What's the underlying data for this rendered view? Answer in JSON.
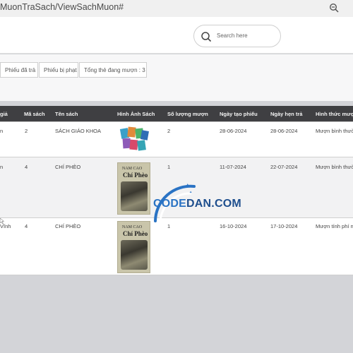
{
  "browser": {
    "url_path": "MuonTraSach/ViewSachMuon#"
  },
  "header": {
    "search_placeholder": "Search here"
  },
  "tabs": [
    {
      "label": "Phiếu đã trả"
    },
    {
      "label": "Phiếu bị phạt"
    },
    {
      "label": "Tổng thẻ đang mượn : 3"
    }
  ],
  "table": {
    "columns": [
      "giả",
      "Mã sách",
      "Tên sách",
      "Hình Ảnh Sách",
      "Số lượng mượn",
      "Ngày tạo phiếu",
      "Ngày hẹn trả",
      "Hình thức mượn"
    ],
    "rows": [
      {
        "reader": "n",
        "book_id": "2",
        "title": "SÁCH GIÁO KHOA",
        "image": "textbook-stack",
        "qty": "2",
        "created": "28-06-2024",
        "due": "28-06-2024",
        "mode": "Mượn bình thường"
      },
      {
        "reader": "n",
        "book_id": "4",
        "title": "CHÍ PHÈO",
        "image": "chi-pheo-cover",
        "qty": "1",
        "created": "11-07-2024",
        "due": "22-07-2024",
        "mode": "Mượn bình thường"
      },
      {
        "reader": "Vĩnh",
        "book_id": "4",
        "title": "CHÍ PHÈO",
        "image": "chi-pheo-cover",
        "qty": "1",
        "created": "16-10-2024",
        "due": "17-10-2024",
        "mode": "Mượn tính phí n"
      }
    ]
  },
  "covers": {
    "small_title": "NAM CAO",
    "big_title": "Chí Phèo"
  },
  "watermark": {
    "part1": "CODE",
    "part2": "DAN.COM",
    "color": "#2a73c4"
  }
}
